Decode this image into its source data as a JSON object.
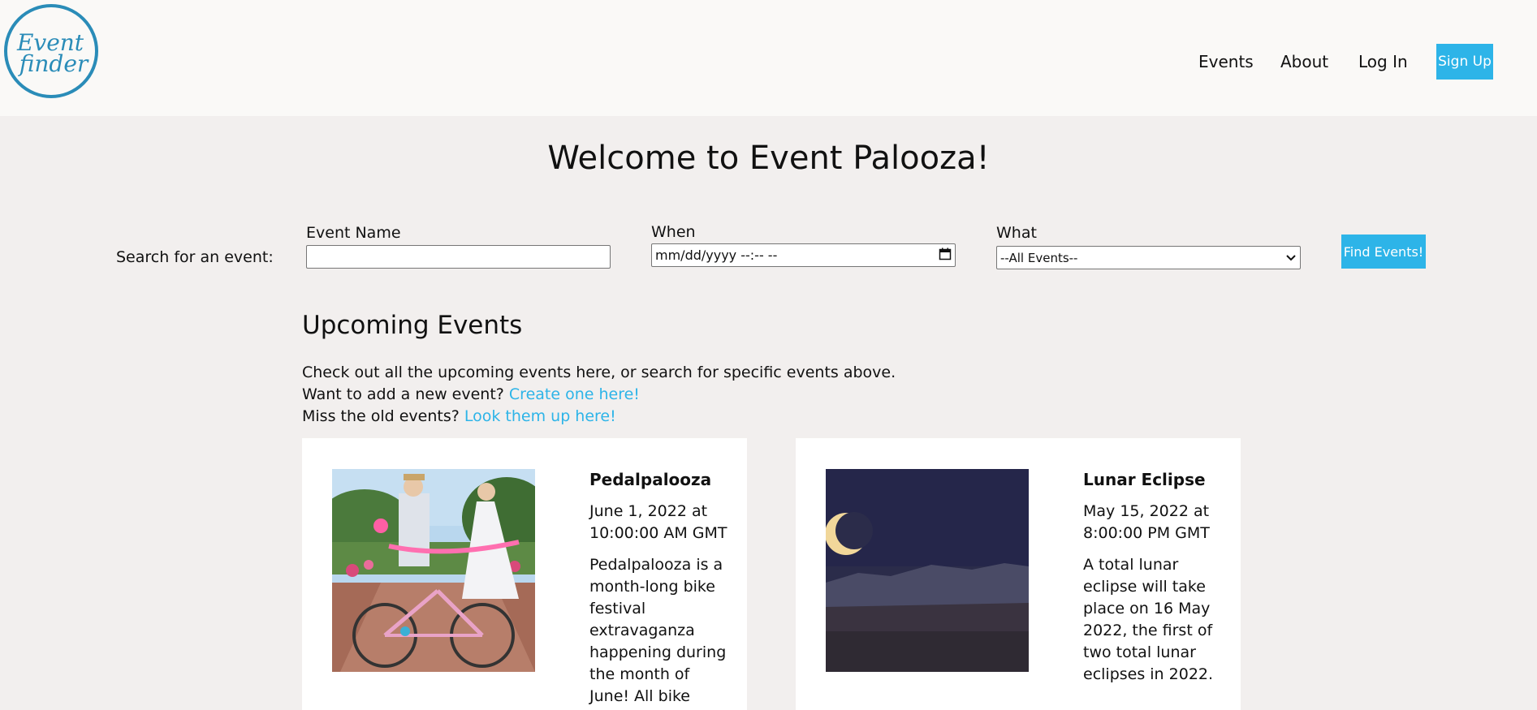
{
  "logo": {
    "line1": "Event",
    "line2": "finder",
    "color": "#2a8cb8"
  },
  "nav": {
    "events": "Events",
    "about": "About",
    "login": "Log In",
    "signup": "Sign Up"
  },
  "welcome": "Welcome to Event Palooza!",
  "search": {
    "label": "Search for an event:",
    "name_label": "Event Name",
    "name_value": "",
    "when_label": "When",
    "when_placeholder": "mm/dd/yyyy --:-- --",
    "what_label": "What",
    "what_selected": "--All Events--",
    "button": "Find Events!"
  },
  "upcoming": {
    "title": "Upcoming Events",
    "line1": "Check out all the upcoming events here, or search for specific events above.",
    "line2_text": "Want to add a new event?",
    "line2_link": "Create one here!",
    "line3_text": "Miss the old events?",
    "line3_link": "Look them up here!"
  },
  "events": [
    {
      "title": "Pedalpalooza",
      "date": "June 1, 2022 at 10:00:00 AM GMT",
      "description": "Pedalpalooza is a month-long bike festival extravaganza happening during the month of June! All bike"
    },
    {
      "title": "Lunar Eclipse",
      "date": "May 15, 2022 at 8:00:00 PM GMT",
      "description": "A total lunar eclipse will take place on 16 May 2022, the first of two total lunar eclipses in 2022."
    }
  ],
  "colors": {
    "accent": "#2db4e8",
    "background": "#f2efee",
    "header": "#faf9f7"
  }
}
